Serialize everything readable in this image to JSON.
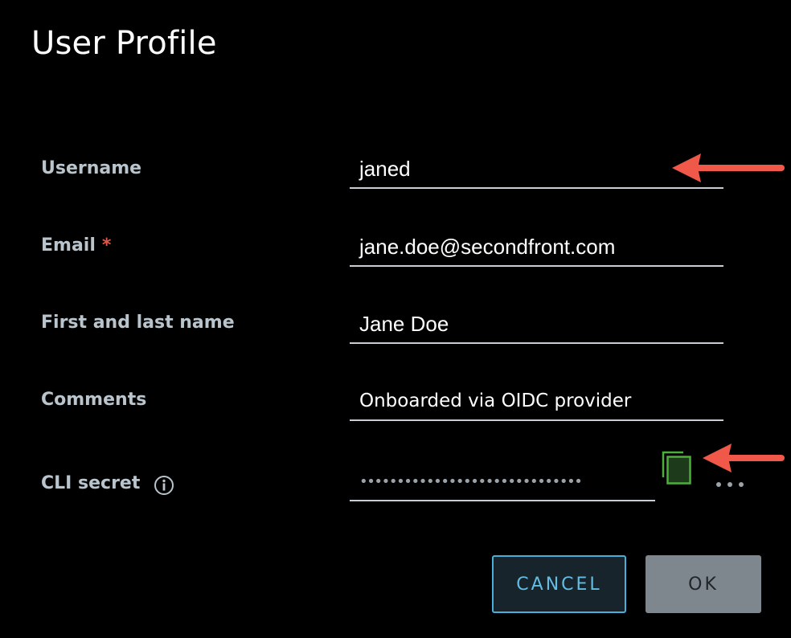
{
  "dialog": {
    "title": "User Profile"
  },
  "form": {
    "username": {
      "label": "Username",
      "value": "janed"
    },
    "email": {
      "label": "Email",
      "required_mark": "*",
      "value": "jane.doe@secondfront.com"
    },
    "full_name": {
      "label": "First and last name",
      "value": "Jane Doe"
    },
    "comments": {
      "label": "Comments",
      "value": "Onboarded via OIDC provider"
    },
    "cli_secret": {
      "label": "CLI secret",
      "masked_value": "••••••••••••••••••••••••••••••",
      "info_icon": "info-icon",
      "copy_icon": "copy-icon",
      "more_icon": "ellipsis-icon"
    }
  },
  "buttons": {
    "cancel_label": "CANCEL",
    "ok_label": "OK"
  },
  "colors": {
    "background": "#000000",
    "label": "#b9c4cc",
    "required": "#e1584b",
    "accent": "#49afd9",
    "copy_icon": "#4caf3a",
    "annotation_arrow": "#f0594a"
  }
}
